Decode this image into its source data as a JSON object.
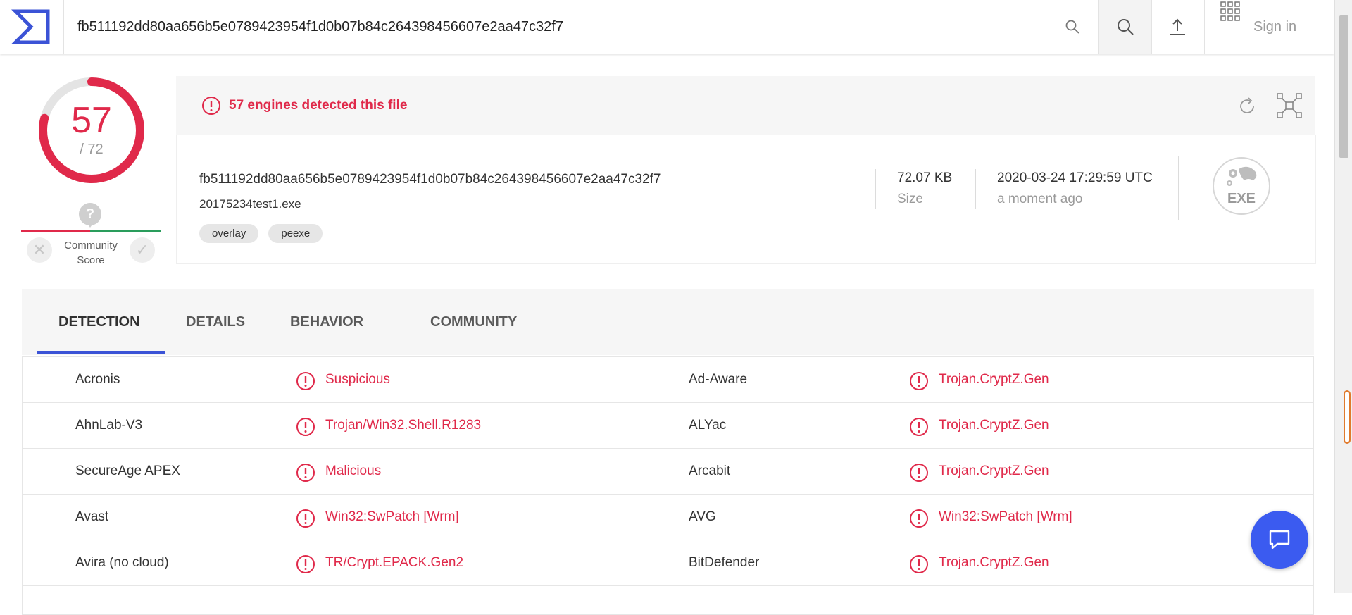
{
  "header": {
    "search_value": "fb511192dd80aa656b5e0789423954f1d0b07b84c264398456607e2aa47c32f7",
    "signin_label": "Sign in",
    "icons": [
      "logo-icon",
      "search-icon",
      "search-icon",
      "upload-icon",
      "apps-grid-icon"
    ]
  },
  "score": {
    "detected": "57",
    "total": "/ 72",
    "fraction": 0.79
  },
  "community": {
    "label_line1": "Community",
    "label_line2": "Score",
    "unknown": "?"
  },
  "banner": {
    "text": "57 engines detected this file"
  },
  "file": {
    "hash": "fb511192dd80aa656b5e0789423954f1d0b07b84c264398456607e2aa47c32f7",
    "name": "20175234test1.exe",
    "tags": [
      "overlay",
      "peexe"
    ],
    "size_value": "72.07 KB",
    "size_label": "Size",
    "date_value": "2020-03-24 17:29:59 UTC",
    "date_label": "a moment ago",
    "type_label": "EXE"
  },
  "tabs": [
    {
      "label": "DETECTION",
      "active": true
    },
    {
      "label": "DETAILS",
      "active": false
    },
    {
      "label": "BEHAVIOR",
      "active": false
    },
    {
      "label": "COMMUNITY",
      "active": false
    }
  ],
  "detections": [
    {
      "engine_l": "Acronis",
      "result_l": "Suspicious",
      "engine_r": "Ad-Aware",
      "result_r": "Trojan.CryptZ.Gen"
    },
    {
      "engine_l": "AhnLab-V3",
      "result_l": "Trojan/Win32.Shell.R1283",
      "engine_r": "ALYac",
      "result_r": "Trojan.CryptZ.Gen"
    },
    {
      "engine_l": "SecureAge APEX",
      "result_l": "Malicious",
      "engine_r": "Arcabit",
      "result_r": "Trojan.CryptZ.Gen"
    },
    {
      "engine_l": "Avast",
      "result_l": "Win32:SwPatch [Wrm]",
      "engine_r": "AVG",
      "result_r": "Win32:SwPatch [Wrm]"
    },
    {
      "engine_l": "Avira (no cloud)",
      "result_l": "TR/Crypt.EPACK.Gen2",
      "engine_r": "BitDefender",
      "result_r": "Trojan.CryptZ.Gen"
    }
  ],
  "colors": {
    "danger": "#e0294a",
    "accent": "#3b53d6",
    "chat": "#3b5bf0"
  }
}
